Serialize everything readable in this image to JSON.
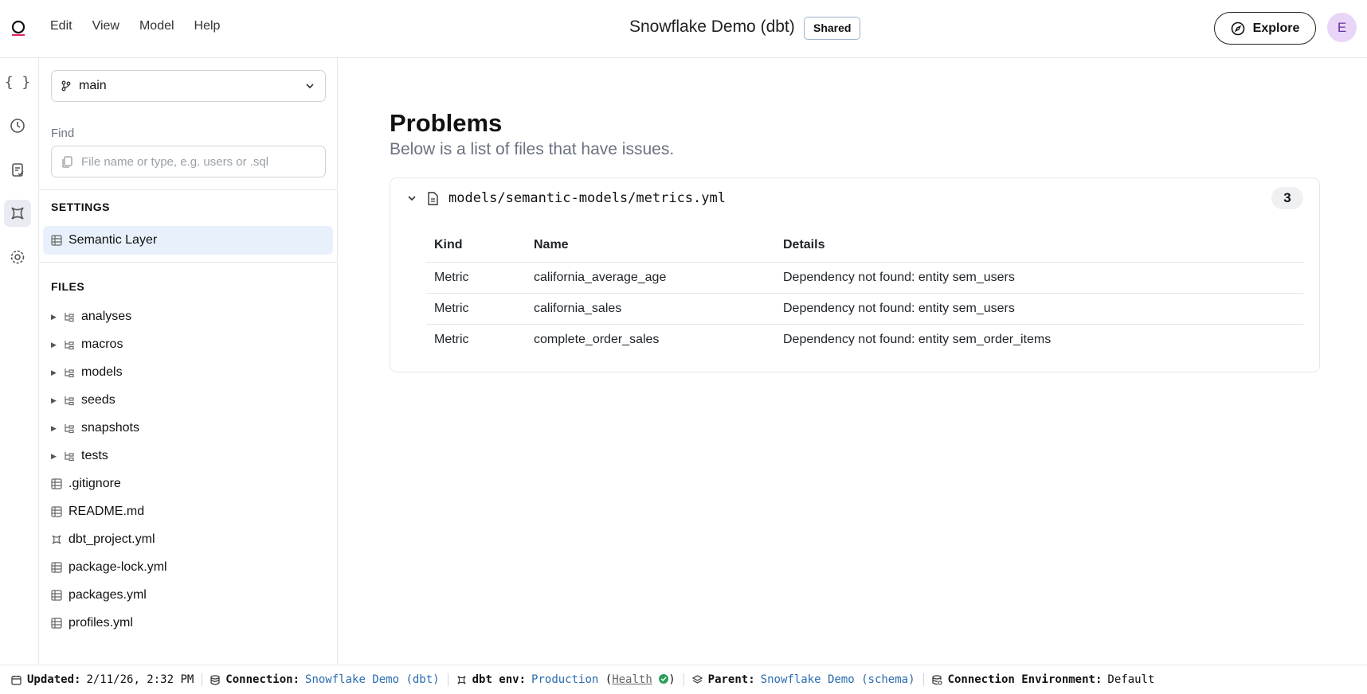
{
  "menu": [
    "Edit",
    "View",
    "Model",
    "Help"
  ],
  "header": {
    "title": "Snowflake Demo (dbt)",
    "badge": "Shared",
    "explore_label": "Explore",
    "avatar_initial": "E"
  },
  "sidebar": {
    "branch": "main",
    "find_label": "Find",
    "find_placeholder": "File name or type, e.g. users or .sql",
    "settings_heading": "SETTINGS",
    "settings_item": "Semantic Layer",
    "files_heading": "FILES",
    "folders": [
      "analyses",
      "macros",
      "models",
      "seeds",
      "snapshots",
      "tests"
    ],
    "files": [
      ".gitignore",
      "README.md",
      "dbt_project.yml",
      "package-lock.yml",
      "packages.yml",
      "profiles.yml"
    ]
  },
  "main": {
    "title": "Problems",
    "subtitle": "Below is a list of files that have issues.",
    "file_path": "models/semantic-models/metrics.yml",
    "problem_count": "3",
    "columns": [
      "Kind",
      "Name",
      "Details"
    ],
    "rows": [
      [
        "Metric",
        "california_average_age",
        "Dependency not found: entity sem_users"
      ],
      [
        "Metric",
        "california_sales",
        "Dependency not found: entity sem_users"
      ],
      [
        "Metric",
        "complete_order_sales",
        "Dependency not found: entity sem_order_items"
      ]
    ]
  },
  "status": {
    "updated_label": "Updated:",
    "updated_value": "2/11/26, 2:32 PM",
    "connection_label": "Connection:",
    "connection_value": "Snowflake Demo (dbt)",
    "env_label": "dbt env:",
    "env_value": "Production",
    "env_health": "Health",
    "parent_label": "Parent:",
    "parent_value": "Snowflake Demo (schema)",
    "conn_env_label": "Connection Environment:",
    "conn_env_value": "Default"
  }
}
